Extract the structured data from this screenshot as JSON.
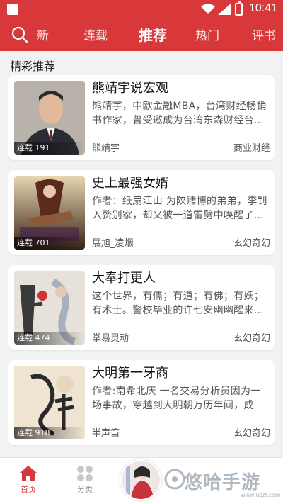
{
  "status_bar": {
    "time": "10:41"
  },
  "top_nav": {
    "tabs": [
      {
        "label": "新",
        "active": false
      },
      {
        "label": "连载",
        "active": false
      },
      {
        "label": "推荐",
        "active": true
      },
      {
        "label": "热门",
        "active": false
      },
      {
        "label": "评书",
        "active": false
      }
    ]
  },
  "section_title": "精彩推荐",
  "books": [
    {
      "title": "熊靖宇说宏观",
      "desc": "熊靖宇，中欧金融MBA，台湾财经畅销书作家，曾受邀成为台湾东森财经台…",
      "author": "熊靖宇",
      "genre": "商业财经",
      "badge": "连载 191"
    },
    {
      "title": "史上最强女婿",
      "desc": "作者：纸扇江山 为陕赌博的弟弟，李钊入赘别家，却又被一道雷劈中唤醒了…",
      "author": "展旭_凌烟",
      "genre": "玄幻奇幻",
      "badge": "连载 701"
    },
    {
      "title": "大奉打更人",
      "desc": "这个世界，有儒；有道；有佛；有妖；有术士。警校毕业的许七安幽幽醒来…",
      "author": "掌易灵动",
      "genre": "玄幻奇幻",
      "badge": "连载 474"
    },
    {
      "title": "大明第一牙商",
      "desc": "作者:南希北庆 一名交易分析员因为一场事故，穿越到大明朝万历年间，成为…",
      "author": "半声笛",
      "genre": "玄幻奇幻",
      "badge": "连载 918"
    }
  ],
  "bottom_nav": {
    "home": "首页",
    "category": "分类"
  },
  "watermark": {
    "text": "悠哈手游",
    "url": "www.uzzf.com"
  },
  "colors": {
    "brand": "#d8383a"
  }
}
